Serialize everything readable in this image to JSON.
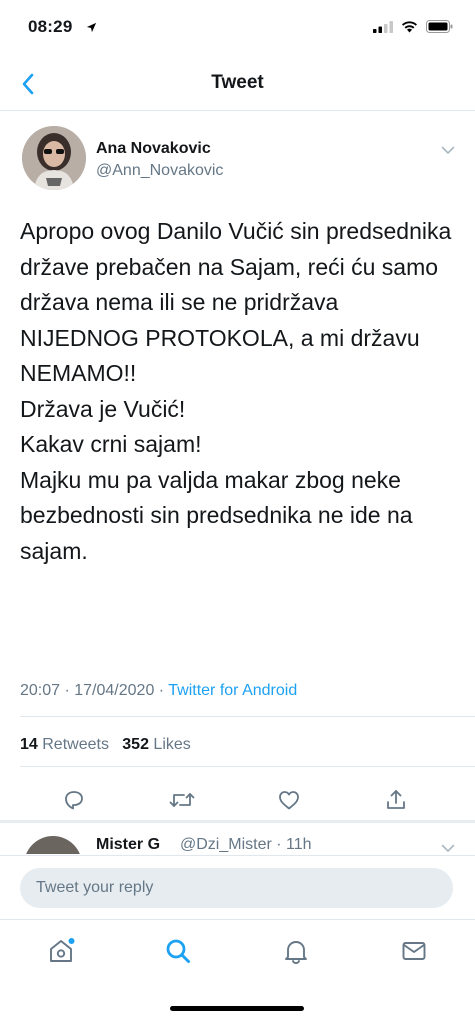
{
  "status_bar": {
    "time": "08:29"
  },
  "nav": {
    "title": "Tweet"
  },
  "tweet": {
    "author_name": "Ana Novakovic",
    "author_handle": "@Ann_Novakovic",
    "body": [
      "Apropo ovog Danilo Vučić sin predsednika države prebačen na Sajam, reći ću samo država nema ili se ne pridržava NIJEDNOG PROTOKOLA, a mi državu NEMAMO!!",
      "Država je Vučić!",
      "Kakav crni sajam!",
      "Majku mu pa valjda makar zbog neke bezbednosti sin predsednika ne ide na sajam."
    ],
    "timestamp": "20:07 · 17/04/2020 · ",
    "source": "Twitter for Android",
    "retweets_count": "14",
    "retweets_label": " Retweets",
    "likes_count": "352",
    "likes_label": " Likes"
  },
  "reply_preview": {
    "name": "Mister G",
    "handle": "@Dzi_Mister",
    "time": " · 11h"
  },
  "compose": {
    "placeholder": "Tweet your reply"
  },
  "colors": {
    "accent": "#1da1f2",
    "secondary_text": "#657786",
    "divider": "#e1e8ed"
  }
}
